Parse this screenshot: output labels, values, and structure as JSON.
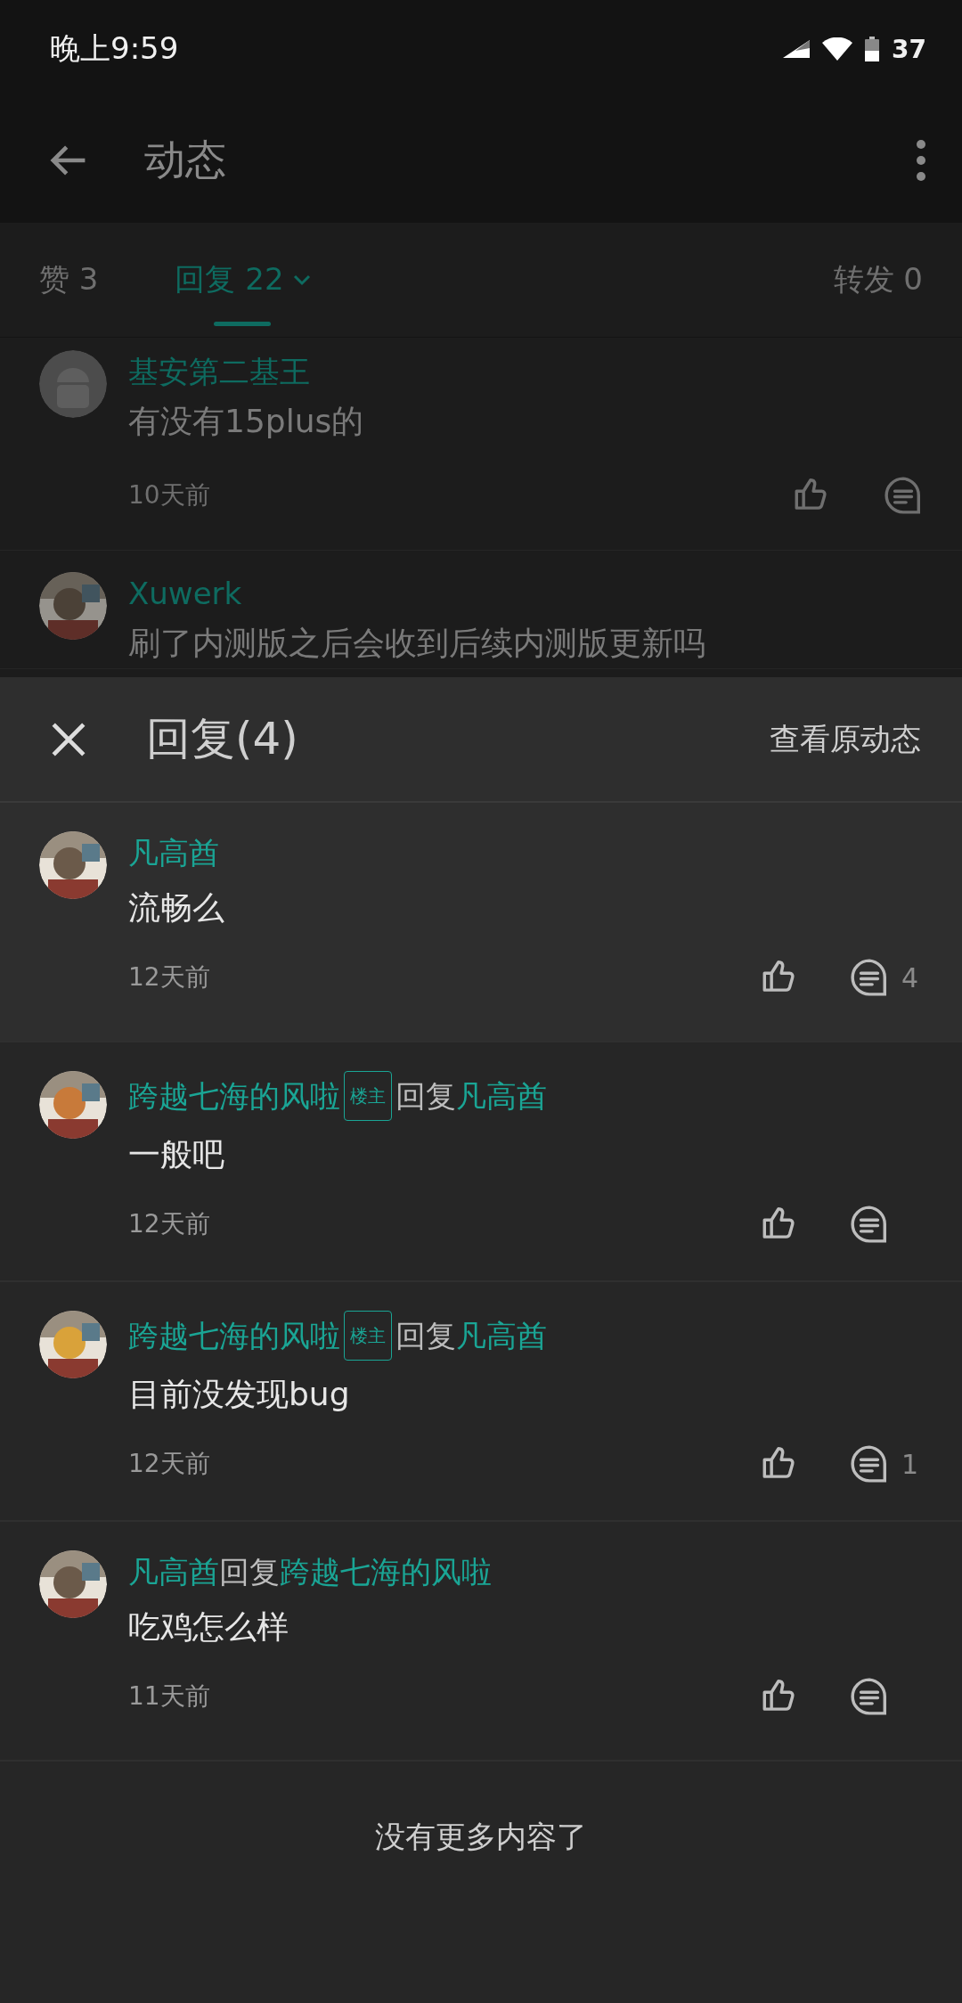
{
  "status_bar": {
    "time": "晚上9:59",
    "battery": "37"
  },
  "app_bar": {
    "title": "动态"
  },
  "tabs": [
    {
      "label": "赞 3",
      "selected": false,
      "dropdown": false
    },
    {
      "label": "回复 22",
      "selected": true,
      "dropdown": true
    },
    {
      "label": "转发 0",
      "selected": false,
      "dropdown": false
    }
  ],
  "comments": [
    {
      "avatar": {
        "kind": "default"
      },
      "name": "基安第二基王",
      "text": "有没有15plus的",
      "time": "10天前"
    },
    {
      "avatar": {
        "kind": "picture"
      },
      "name": "Xuwerk",
      "text": "刷了内测版之后会收到后续内测版更新吗"
    }
  ],
  "reply_sheet": {
    "title": "回复(4)",
    "link": "查看原动态",
    "replies": [
      {
        "kind": "parent",
        "avatar": {
          "kind": "picture"
        },
        "header": [
          {
            "kind": "name",
            "text": "凡高酋"
          }
        ],
        "text": "流畅么",
        "time": "12天前",
        "reply_count": "4"
      },
      {
        "kind": "reply",
        "avatar": {
          "kind": "picture"
        },
        "header": [
          {
            "kind": "name",
            "text": "跨越七海的风啦"
          },
          {
            "kind": "badge",
            "text": "楼主"
          },
          {
            "kind": "text",
            "text": "回复"
          },
          {
            "kind": "name",
            "text": "凡高酋"
          }
        ],
        "text": "一般吧",
        "time": "12天前"
      },
      {
        "kind": "reply",
        "avatar": {
          "kind": "picture"
        },
        "header": [
          {
            "kind": "name",
            "text": "跨越七海的风啦"
          },
          {
            "kind": "badge",
            "text": "楼主"
          },
          {
            "kind": "text",
            "text": "回复"
          },
          {
            "kind": "name",
            "text": "凡高酋"
          }
        ],
        "text": "目前没发现bug",
        "time": "12天前",
        "reply_count": "1"
      },
      {
        "kind": "reply",
        "avatar": {
          "kind": "picture"
        },
        "header": [
          {
            "kind": "name",
            "text": "凡高酋"
          },
          {
            "kind": "text",
            "text": "回复"
          },
          {
            "kind": "name",
            "text": "跨越七海的风啦"
          }
        ],
        "text": "吃鸡怎么样",
        "time": "11天前"
      }
    ],
    "footer": "没有更多内容了"
  }
}
